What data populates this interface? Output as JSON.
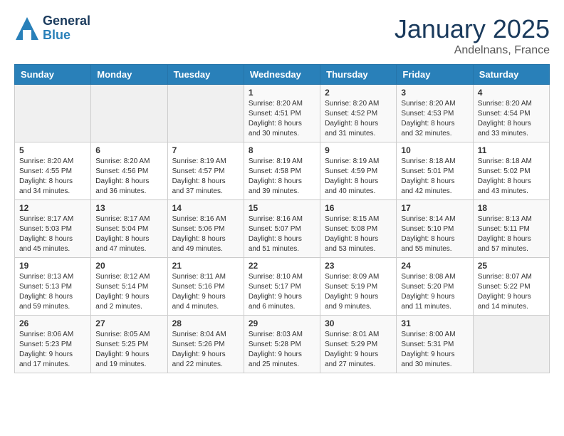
{
  "header": {
    "logo_line1": "General",
    "logo_line2": "Blue",
    "month": "January 2025",
    "location": "Andelnans, France"
  },
  "weekdays": [
    "Sunday",
    "Monday",
    "Tuesday",
    "Wednesday",
    "Thursday",
    "Friday",
    "Saturday"
  ],
  "weeks": [
    [
      {
        "day": "",
        "sunrise": "",
        "sunset": "",
        "daylight": ""
      },
      {
        "day": "",
        "sunrise": "",
        "sunset": "",
        "daylight": ""
      },
      {
        "day": "",
        "sunrise": "",
        "sunset": "",
        "daylight": ""
      },
      {
        "day": "1",
        "sunrise": "Sunrise: 8:20 AM",
        "sunset": "Sunset: 4:51 PM",
        "daylight": "Daylight: 8 hours and 30 minutes."
      },
      {
        "day": "2",
        "sunrise": "Sunrise: 8:20 AM",
        "sunset": "Sunset: 4:52 PM",
        "daylight": "Daylight: 8 hours and 31 minutes."
      },
      {
        "day": "3",
        "sunrise": "Sunrise: 8:20 AM",
        "sunset": "Sunset: 4:53 PM",
        "daylight": "Daylight: 8 hours and 32 minutes."
      },
      {
        "day": "4",
        "sunrise": "Sunrise: 8:20 AM",
        "sunset": "Sunset: 4:54 PM",
        "daylight": "Daylight: 8 hours and 33 minutes."
      }
    ],
    [
      {
        "day": "5",
        "sunrise": "Sunrise: 8:20 AM",
        "sunset": "Sunset: 4:55 PM",
        "daylight": "Daylight: 8 hours and 34 minutes."
      },
      {
        "day": "6",
        "sunrise": "Sunrise: 8:20 AM",
        "sunset": "Sunset: 4:56 PM",
        "daylight": "Daylight: 8 hours and 36 minutes."
      },
      {
        "day": "7",
        "sunrise": "Sunrise: 8:19 AM",
        "sunset": "Sunset: 4:57 PM",
        "daylight": "Daylight: 8 hours and 37 minutes."
      },
      {
        "day": "8",
        "sunrise": "Sunrise: 8:19 AM",
        "sunset": "Sunset: 4:58 PM",
        "daylight": "Daylight: 8 hours and 39 minutes."
      },
      {
        "day": "9",
        "sunrise": "Sunrise: 8:19 AM",
        "sunset": "Sunset: 4:59 PM",
        "daylight": "Daylight: 8 hours and 40 minutes."
      },
      {
        "day": "10",
        "sunrise": "Sunrise: 8:18 AM",
        "sunset": "Sunset: 5:01 PM",
        "daylight": "Daylight: 8 hours and 42 minutes."
      },
      {
        "day": "11",
        "sunrise": "Sunrise: 8:18 AM",
        "sunset": "Sunset: 5:02 PM",
        "daylight": "Daylight: 8 hours and 43 minutes."
      }
    ],
    [
      {
        "day": "12",
        "sunrise": "Sunrise: 8:17 AM",
        "sunset": "Sunset: 5:03 PM",
        "daylight": "Daylight: 8 hours and 45 minutes."
      },
      {
        "day": "13",
        "sunrise": "Sunrise: 8:17 AM",
        "sunset": "Sunset: 5:04 PM",
        "daylight": "Daylight: 8 hours and 47 minutes."
      },
      {
        "day": "14",
        "sunrise": "Sunrise: 8:16 AM",
        "sunset": "Sunset: 5:06 PM",
        "daylight": "Daylight: 8 hours and 49 minutes."
      },
      {
        "day": "15",
        "sunrise": "Sunrise: 8:16 AM",
        "sunset": "Sunset: 5:07 PM",
        "daylight": "Daylight: 8 hours and 51 minutes."
      },
      {
        "day": "16",
        "sunrise": "Sunrise: 8:15 AM",
        "sunset": "Sunset: 5:08 PM",
        "daylight": "Daylight: 8 hours and 53 minutes."
      },
      {
        "day": "17",
        "sunrise": "Sunrise: 8:14 AM",
        "sunset": "Sunset: 5:10 PM",
        "daylight": "Daylight: 8 hours and 55 minutes."
      },
      {
        "day": "18",
        "sunrise": "Sunrise: 8:13 AM",
        "sunset": "Sunset: 5:11 PM",
        "daylight": "Daylight: 8 hours and 57 minutes."
      }
    ],
    [
      {
        "day": "19",
        "sunrise": "Sunrise: 8:13 AM",
        "sunset": "Sunset: 5:13 PM",
        "daylight": "Daylight: 8 hours and 59 minutes."
      },
      {
        "day": "20",
        "sunrise": "Sunrise: 8:12 AM",
        "sunset": "Sunset: 5:14 PM",
        "daylight": "Daylight: 9 hours and 2 minutes."
      },
      {
        "day": "21",
        "sunrise": "Sunrise: 8:11 AM",
        "sunset": "Sunset: 5:16 PM",
        "daylight": "Daylight: 9 hours and 4 minutes."
      },
      {
        "day": "22",
        "sunrise": "Sunrise: 8:10 AM",
        "sunset": "Sunset: 5:17 PM",
        "daylight": "Daylight: 9 hours and 6 minutes."
      },
      {
        "day": "23",
        "sunrise": "Sunrise: 8:09 AM",
        "sunset": "Sunset: 5:19 PM",
        "daylight": "Daylight: 9 hours and 9 minutes."
      },
      {
        "day": "24",
        "sunrise": "Sunrise: 8:08 AM",
        "sunset": "Sunset: 5:20 PM",
        "daylight": "Daylight: 9 hours and 11 minutes."
      },
      {
        "day": "25",
        "sunrise": "Sunrise: 8:07 AM",
        "sunset": "Sunset: 5:22 PM",
        "daylight": "Daylight: 9 hours and 14 minutes."
      }
    ],
    [
      {
        "day": "26",
        "sunrise": "Sunrise: 8:06 AM",
        "sunset": "Sunset: 5:23 PM",
        "daylight": "Daylight: 9 hours and 17 minutes."
      },
      {
        "day": "27",
        "sunrise": "Sunrise: 8:05 AM",
        "sunset": "Sunset: 5:25 PM",
        "daylight": "Daylight: 9 hours and 19 minutes."
      },
      {
        "day": "28",
        "sunrise": "Sunrise: 8:04 AM",
        "sunset": "Sunset: 5:26 PM",
        "daylight": "Daylight: 9 hours and 22 minutes."
      },
      {
        "day": "29",
        "sunrise": "Sunrise: 8:03 AM",
        "sunset": "Sunset: 5:28 PM",
        "daylight": "Daylight: 9 hours and 25 minutes."
      },
      {
        "day": "30",
        "sunrise": "Sunrise: 8:01 AM",
        "sunset": "Sunset: 5:29 PM",
        "daylight": "Daylight: 9 hours and 27 minutes."
      },
      {
        "day": "31",
        "sunrise": "Sunrise: 8:00 AM",
        "sunset": "Sunset: 5:31 PM",
        "daylight": "Daylight: 9 hours and 30 minutes."
      },
      {
        "day": "",
        "sunrise": "",
        "sunset": "",
        "daylight": ""
      }
    ]
  ]
}
